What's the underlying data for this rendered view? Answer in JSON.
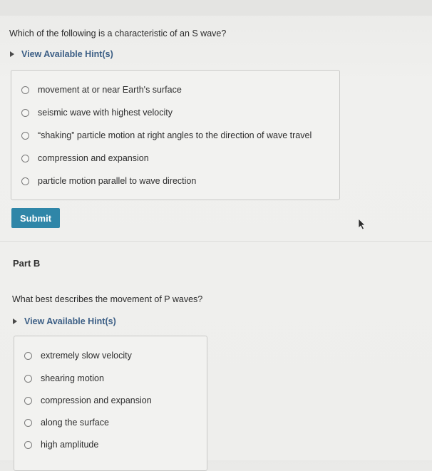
{
  "partA": {
    "question": "Which of the following is a characteristic of an S wave?",
    "hint_label": "View Available Hint(s)",
    "choices": [
      "movement at or near Earth's surface",
      "seismic wave with highest velocity",
      "“shaking” particle motion at right angles to the direction of wave travel",
      "compression and expansion",
      "particle motion parallel to wave direction"
    ],
    "submit_label": "Submit"
  },
  "partB": {
    "title": "Part B",
    "question": "What best describes the movement of P waves?",
    "hint_label": "View Available Hint(s)",
    "choices": [
      "extremely slow velocity",
      "shearing motion",
      "compression and expansion",
      "along the surface",
      "high amplitude"
    ]
  },
  "icons": {
    "hint_caret": "caret-right-icon",
    "pointer": "mouse-pointer-icon"
  },
  "colors": {
    "hint_link": "#3b5e85",
    "submit_bg": "#2f86a8"
  }
}
